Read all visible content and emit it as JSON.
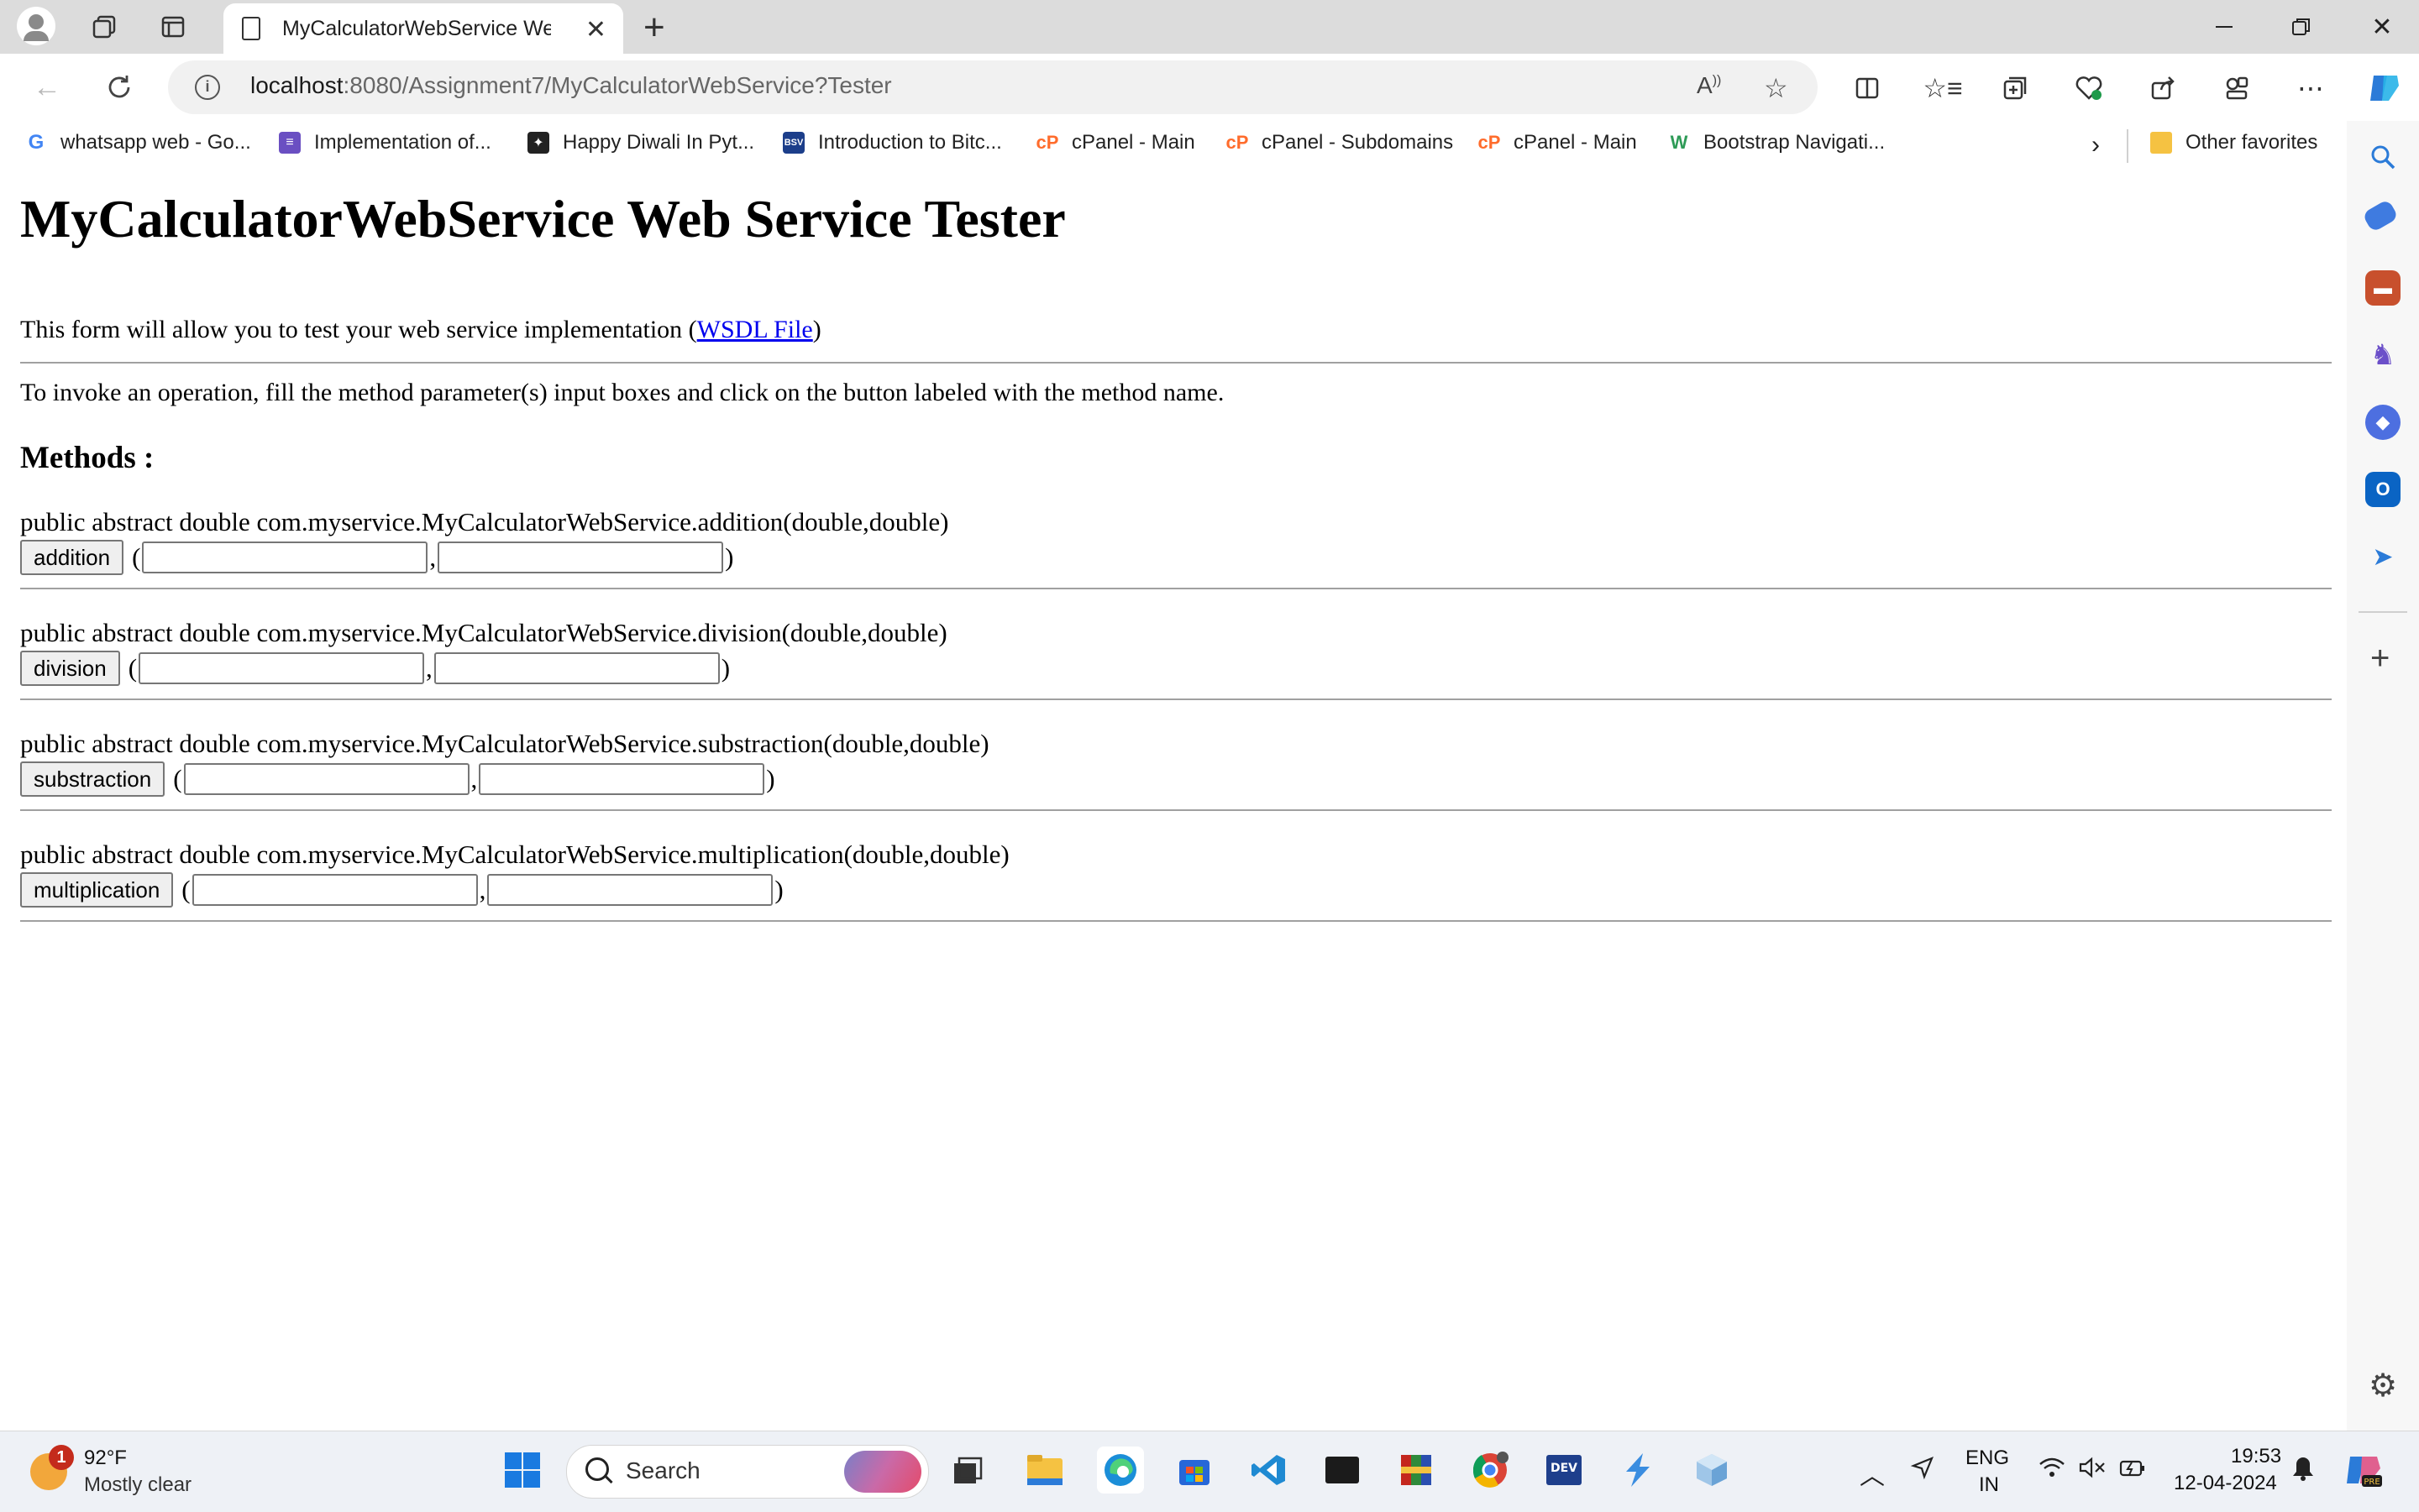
{
  "browser": {
    "tab_title": "MyCalculatorWebService Web Se",
    "url_host": "localhost",
    "url_rest": ":8080/Assignment7/MyCalculatorWebService?Tester",
    "bookmarks": [
      {
        "label": "whatsapp web - Go...",
        "icon": "google-icon",
        "color": "#4285f4"
      },
      {
        "label": "Implementation of...",
        "icon": "list-icon",
        "color": "#6a4fc2"
      },
      {
        "label": "Happy Diwali In Pyt...",
        "icon": "image-icon",
        "color": "#222222"
      },
      {
        "label": "Introduction to Bitc...",
        "icon": "bsv-icon",
        "color": "#1c3e8a"
      },
      {
        "label": "cPanel - Main",
        "icon": "cpanel-icon",
        "color": "#ff6c2c"
      },
      {
        "label": "cPanel - Subdomains",
        "icon": "cpanel-icon",
        "color": "#ff6c2c"
      },
      {
        "label": "cPanel - Main",
        "icon": "cpanel-icon",
        "color": "#ff6c2c"
      },
      {
        "label": "Bootstrap Navigati...",
        "icon": "w3-icon",
        "color": "#2e9b57"
      }
    ],
    "other_favorites": "Other favorites"
  },
  "page": {
    "title": "MyCalculatorWebService Web Service Tester",
    "intro_text": "This form will allow you to test your web service implementation (",
    "wsdl_link": "WSDL File",
    "intro_close": ")",
    "instructions": "To invoke an operation, fill the method parameter(s) input boxes and click on the button labeled with the method name.",
    "methods_heading": "Methods :",
    "methods": [
      {
        "signature": "public abstract double com.myservice.MyCalculatorWebService.addition(double,double)",
        "button": "addition"
      },
      {
        "signature": "public abstract double com.myservice.MyCalculatorWebService.division(double,double)",
        "button": "division"
      },
      {
        "signature": "public abstract double com.myservice.MyCalculatorWebService.substraction(double,double)",
        "button": "substraction"
      },
      {
        "signature": "public abstract double com.myservice.MyCalculatorWebService.multiplication(double,double)",
        "button": "multiplication"
      }
    ],
    "paren_open": "(",
    "comma": ",",
    "paren_close": ")"
  },
  "taskbar": {
    "weather_badge": "1",
    "temperature": "92°F",
    "condition": "Mostly clear",
    "search_label": "Search",
    "lang_top": "ENG",
    "lang_bottom": "IN",
    "time": "19:53",
    "date": "12-04-2024"
  },
  "colors": {
    "link": "#0000ee",
    "accent": "#0078d4"
  }
}
